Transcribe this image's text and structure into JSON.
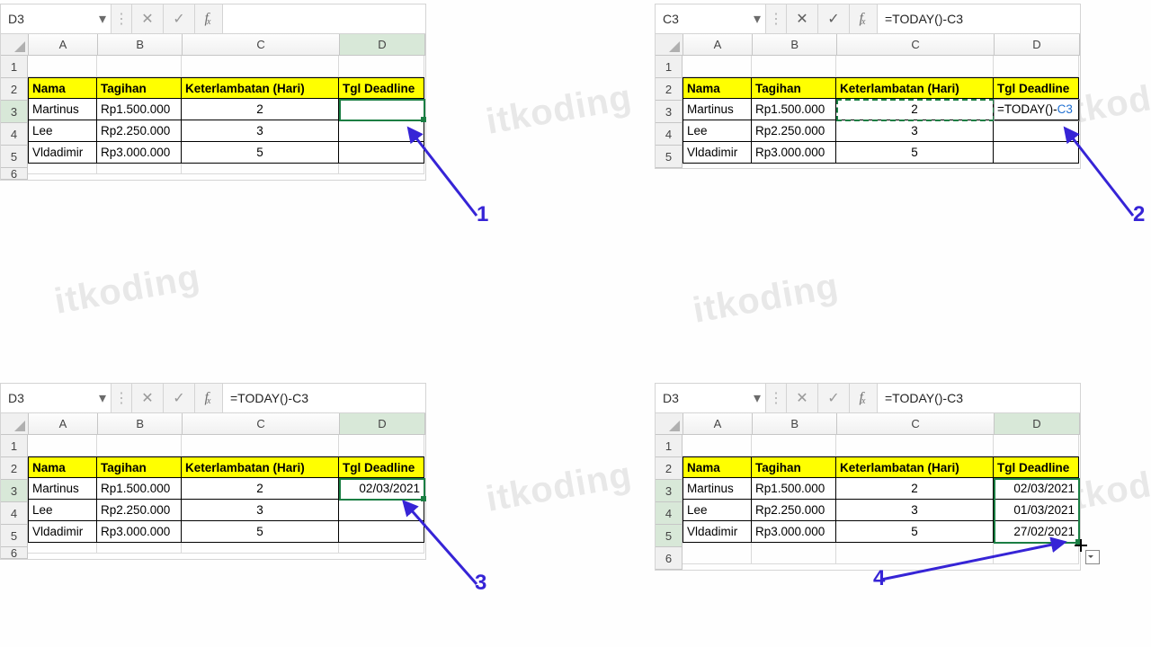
{
  "columns": [
    "A",
    "B",
    "C",
    "D"
  ],
  "headers": {
    "a": "Nama",
    "b": "Tagihan",
    "c": "Keterlambatan (Hari)",
    "d": "Tgl Deadline"
  },
  "dataRows": [
    {
      "a": "Martinus",
      "b": "Rp1.500.000",
      "c": "2"
    },
    {
      "a": "Lee",
      "b": "Rp2.250.000",
      "c": "3"
    },
    {
      "a": "Vldadimir",
      "b": "Rp3.000.000",
      "c": "5"
    }
  ],
  "panels": {
    "p1": {
      "namebox": "D3",
      "formula": "",
      "d3": "",
      "annotNum": "1"
    },
    "p2": {
      "namebox": "C3",
      "formula_prefix": "=TODAY()-",
      "formula_ref": "C3",
      "d3_prefix": "=TODAY()-",
      "d3_ref": "C3",
      "annotNum": "2"
    },
    "p3": {
      "namebox": "D3",
      "formula": "=TODAY()-C3",
      "d3": "02/03/2021",
      "annotNum": "3"
    },
    "p4": {
      "namebox": "D3",
      "formula": "=TODAY()-C3",
      "d3": "02/03/2021",
      "d4": "01/03/2021",
      "d5": "27/02/2021",
      "annotNum": "4"
    }
  },
  "rowNums": [
    "1",
    "2",
    "3",
    "4",
    "5",
    "6"
  ],
  "watermark": "itkoding",
  "colWidths": {
    "a": 77,
    "b": 94,
    "c": 175,
    "d": 95
  },
  "chart_data": {
    "type": "table",
    "headers": [
      "Nama",
      "Tagihan",
      "Keterlambatan (Hari)",
      "Tgl Deadline"
    ],
    "rows": [
      [
        "Martinus",
        "Rp1.500.000",
        2,
        "02/03/2021"
      ],
      [
        "Lee",
        "Rp2.250.000",
        3,
        "01/03/2021"
      ],
      [
        "Vldadimir",
        "Rp3.000.000",
        5,
        "27/02/2021"
      ]
    ],
    "formula_D": "=TODAY()-C"
  }
}
